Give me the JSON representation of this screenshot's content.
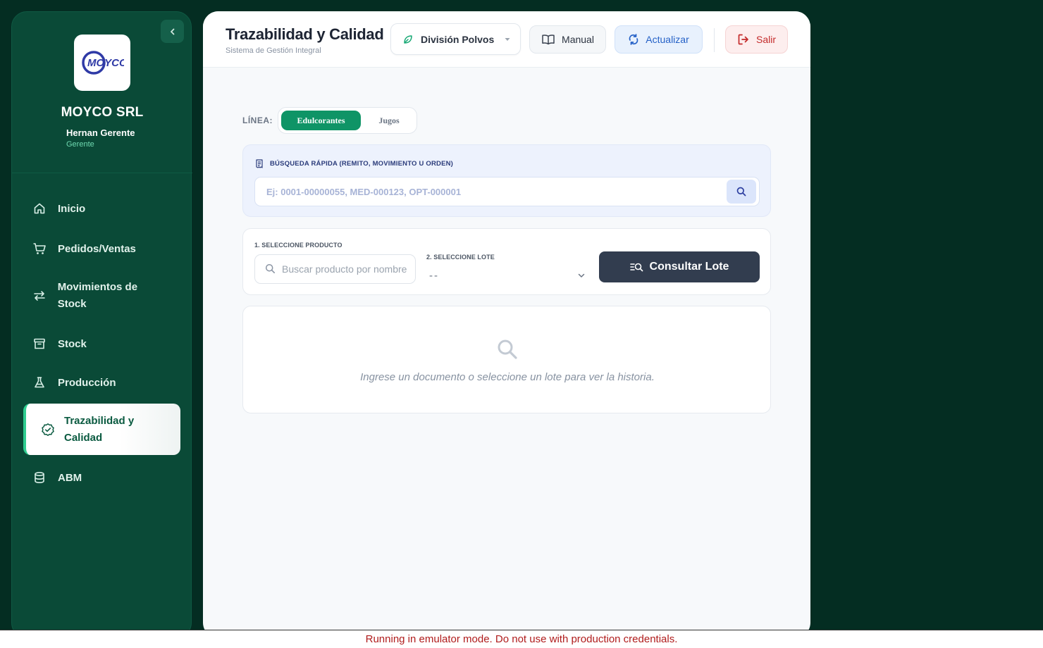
{
  "sidebar": {
    "logo_text": "MOYCO",
    "company": "MOYCO SRL",
    "user_name": "Hernan Gerente",
    "user_role": "Gerente",
    "nav": [
      {
        "label": "Inicio",
        "icon": "home-icon"
      },
      {
        "label": "Pedidos/Ventas",
        "icon": "cart-icon"
      },
      {
        "label": "Movimientos de Stock",
        "icon": "arrows-exchange-icon"
      },
      {
        "label": "Stock",
        "icon": "archive-box-icon"
      },
      {
        "label": "Producción",
        "icon": "flask-icon"
      },
      {
        "label": "Trazabilidad y Calidad",
        "icon": "badge-check-icon",
        "active": true
      },
      {
        "label": "ABM",
        "icon": "database-icon"
      }
    ]
  },
  "header": {
    "title": "Trazabilidad y Calidad",
    "subtitle": "Sistema de Gestión Integral",
    "division": "División Polvos",
    "manual": "Manual",
    "update": "Actualizar",
    "logout": "Salir"
  },
  "line": {
    "label": "LÍNEA:",
    "options": [
      "Edulcorantes",
      "Jugos"
    ],
    "selected": "Edulcorantes"
  },
  "quick_search": {
    "title": "BÚSQUEDA RÁPIDA (REMITO, MOVIMIENTO U ORDEN)",
    "placeholder": "Ej: 0001-00000055, MED-000123, OPT-000001"
  },
  "selection": {
    "product_label": "1. SELECCIONE PRODUCTO",
    "product_placeholder": "Buscar producto por nombre",
    "lot_label": "2. SELECCIONE LOTE",
    "lot_value": "--",
    "consult_button": "Consultar Lote"
  },
  "empty_state": {
    "message": "Ingrese un documento o seleccione un lote para ver la historia."
  },
  "emulator_notice": "Running in emulator mode. Do not use with production credentials.",
  "colors": {
    "sidebar_bg": "#0a4a37",
    "page_bg": "#042d22",
    "accent_green": "#0f9466",
    "consult_btn": "#323d4f",
    "logout_red": "#c42b2b",
    "update_blue": "#2561c7"
  }
}
